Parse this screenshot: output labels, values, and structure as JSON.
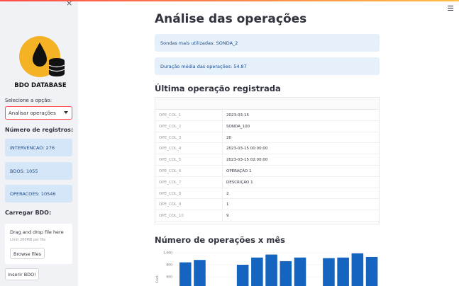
{
  "app": {
    "logo_text": "BDO DATABASE",
    "close_symbol": "×"
  },
  "sidebar": {
    "select_label": "Selecione a opção:",
    "select_value": "Analisar operações",
    "records_heading": "Número de registros:",
    "counts": [
      {
        "label": "INTERVENCAO: 276"
      },
      {
        "label": "BDOS: 1055"
      },
      {
        "label": "OPERACOES: 10546"
      }
    ],
    "upload_heading": "Carregar BDO:",
    "upload_text": "Drag and drop file here",
    "upload_limit": "Limit 200MB per file",
    "browse_label": "Browse files",
    "insert_label": "Inserir BDO!"
  },
  "main": {
    "title": "Análise das operações",
    "info_probes": "Sondas mais utilizadas: SONDA_2",
    "info_duration": "Duração média das operações: 54.87",
    "last_op_heading": "Última operação registrada",
    "table_rows": [
      {
        "key": "OPE_COL_1",
        "value": "2023-03-15"
      },
      {
        "key": "OPE_COL_2",
        "value": "SONDA_100"
      },
      {
        "key": "OPE_COL_3",
        "value": "20"
      },
      {
        "key": "OPE_COL_4",
        "value": "2023-03-15 00:00:00"
      },
      {
        "key": "OPE_COL_5",
        "value": "2023-03-15 02:00:00"
      },
      {
        "key": "OPE_COL_6",
        "value": "OPERAÇÃO 1"
      },
      {
        "key": "OPE_COL_7",
        "value": "DESCRIÇÃO 1"
      },
      {
        "key": "OPE_COL_8",
        "value": "2"
      },
      {
        "key": "OPE_COL_9",
        "value": "1"
      },
      {
        "key": "OPE_COL_10",
        "value": "9"
      }
    ],
    "chart_heading": "Número de operações x mês"
  },
  "chart_data": {
    "type": "bar",
    "color": "#1565c0",
    "categories": [
      "",
      "",
      "",
      "",
      "",
      "",
      "",
      "",
      "",
      "",
      "",
      "",
      "",
      ""
    ],
    "values": [
      840,
      880,
      0,
      0,
      800,
      920,
      970,
      860,
      920,
      0,
      910,
      920,
      990,
      930
    ],
    "yticks": [
      "1,000",
      "800",
      "600"
    ],
    "ylabel": "Cont.",
    "ylim": [
      0,
      1000
    ]
  },
  "colors": {
    "accent": "#ff4b4b",
    "info_bg": "#d6e6f9",
    "info_text": "#1e4c86",
    "bar": "#1565c0"
  }
}
